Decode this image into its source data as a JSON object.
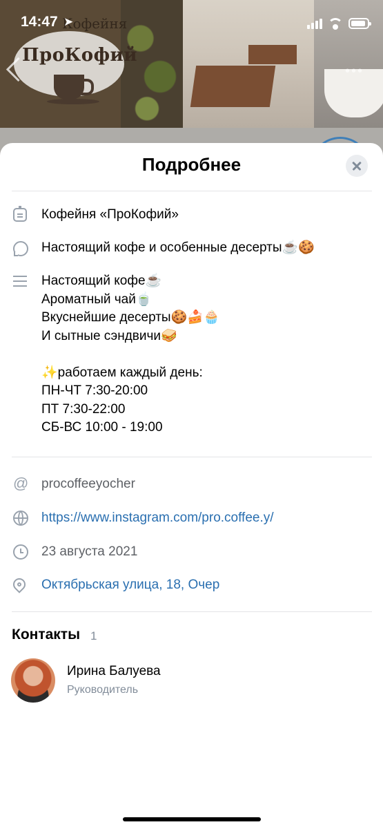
{
  "status_bar": {
    "time": "14:47",
    "location_arrow": "location-arrow-icon"
  },
  "cover": {
    "logo_text": "ПроКофий",
    "logo_top_text": "Кофейня"
  },
  "sheet": {
    "title": "Подробнее",
    "name": "Кофейня «ПроКофий»",
    "status": "Настоящий кофе и особенные десерты☕️🍪",
    "description": "Настоящий кофе☕️\nАроматный чай🍵\nВкуснейшие десерты🍪🍰🧁\nИ сытные сэндвичи🥪\n\n✨работаем каждый день:\nПН-ЧТ 7:30-20:00\nПТ 7:30-22:00\nСБ-ВС 10:00 - 19:00",
    "screen_name": "procoffeeyocher",
    "website": "https://www.instagram.com/pro.coffee.y/",
    "founded": "23 августа 2021",
    "address": "Октябрьская улица, 18, Очер"
  },
  "contacts": {
    "title": "Контакты",
    "count": "1",
    "items": [
      {
        "name": "Ирина Балуева",
        "role": "Руководитель"
      }
    ]
  },
  "colors": {
    "link": "#2a6fb0",
    "icon": "#99a2ad",
    "secondary_text": "#818c99"
  }
}
